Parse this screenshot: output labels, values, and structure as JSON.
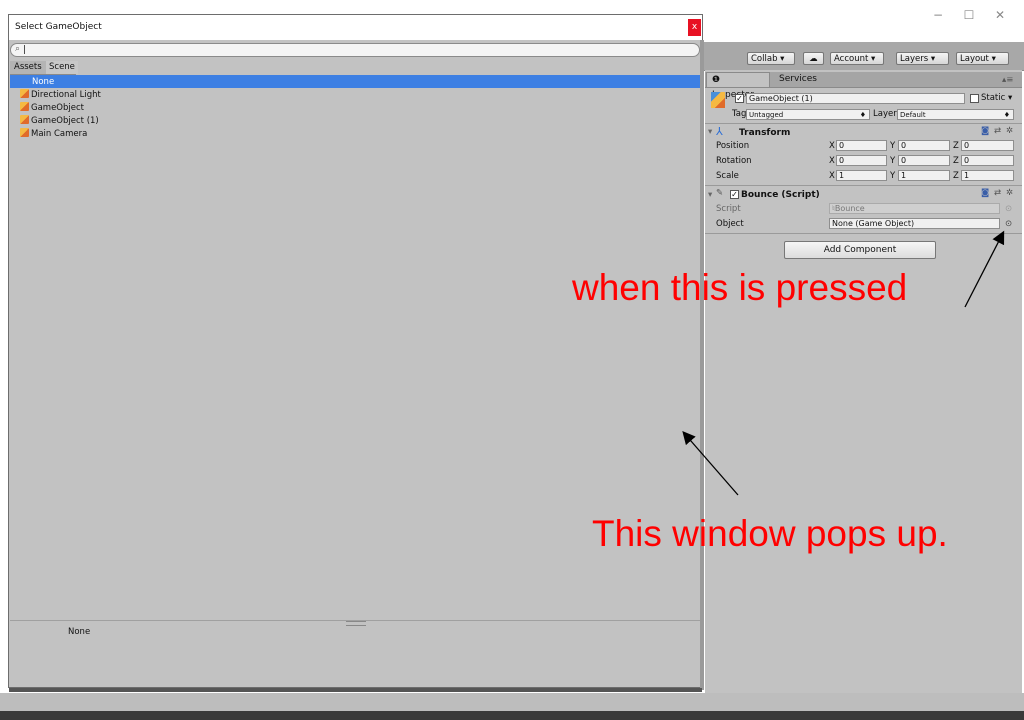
{
  "popup": {
    "title": "Select GameObject",
    "close_label": "x",
    "search_value": "|",
    "tabs": [
      "Assets",
      "Scene"
    ],
    "items": [
      "None",
      "Directional Light",
      "GameObject",
      "GameObject (1)",
      "Main Camera"
    ],
    "selected_item": "None",
    "preview_label": "None"
  },
  "window_controls": {
    "minimize": "−",
    "maximize": "☐",
    "close": "✕"
  },
  "toolbar": {
    "collab": "Collab ▾",
    "account": "Account ▾",
    "layers": "Layers ▾",
    "layout": "Layout ▾"
  },
  "inspector": {
    "tabs": [
      "Inspector",
      "Services"
    ],
    "object_name": "GameObject (1)",
    "static_label": "Static ▾",
    "tag_label": "Tag",
    "tag_value": "Untagged",
    "layer_label": "Layer",
    "layer_value": "Default",
    "transform": {
      "title": "Transform",
      "rows": [
        {
          "label": "Position",
          "x": "0",
          "y": "0",
          "z": "0"
        },
        {
          "label": "Rotation",
          "x": "0",
          "y": "0",
          "z": "0"
        },
        {
          "label": "Scale",
          "x": "1",
          "y": "1",
          "z": "1"
        }
      ],
      "axis": [
        "X",
        "Y",
        "Z"
      ]
    },
    "script_component": {
      "title": "Bounce (Script)",
      "script_label": "Script",
      "script_value": "Bounce",
      "object_label": "Object",
      "object_value": "None (Game Object)"
    },
    "add_component": "Add Component"
  },
  "annotations": {
    "top_note": "when this is pressed",
    "bottom_note": "This window pops up.",
    "color": "#ff0000"
  }
}
